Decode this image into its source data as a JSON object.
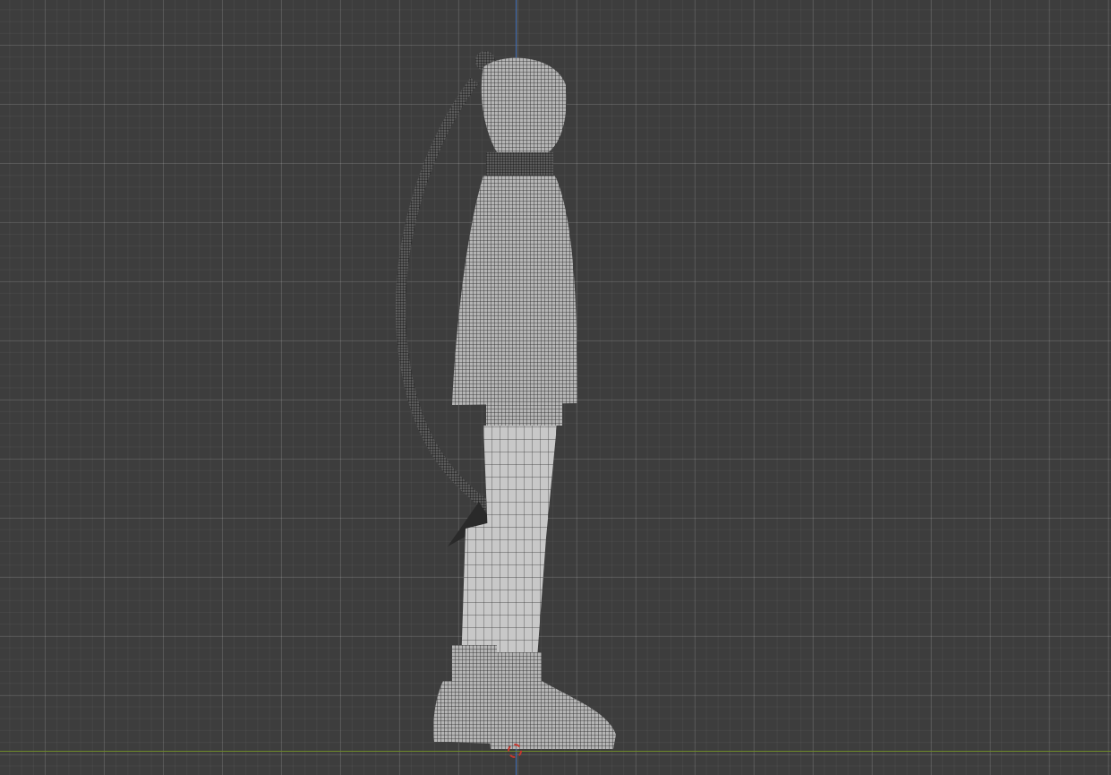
{
  "viewport": {
    "mode": "wireframe",
    "view": "side",
    "colors": {
      "background": "#3d3d3d",
      "z_axis": "#3f6db5",
      "y_axis": "#6f8a2a",
      "cursor": "#c4382f",
      "mesh_light": "#c8c8c8",
      "mesh_dark": "#1a1a1a"
    }
  }
}
